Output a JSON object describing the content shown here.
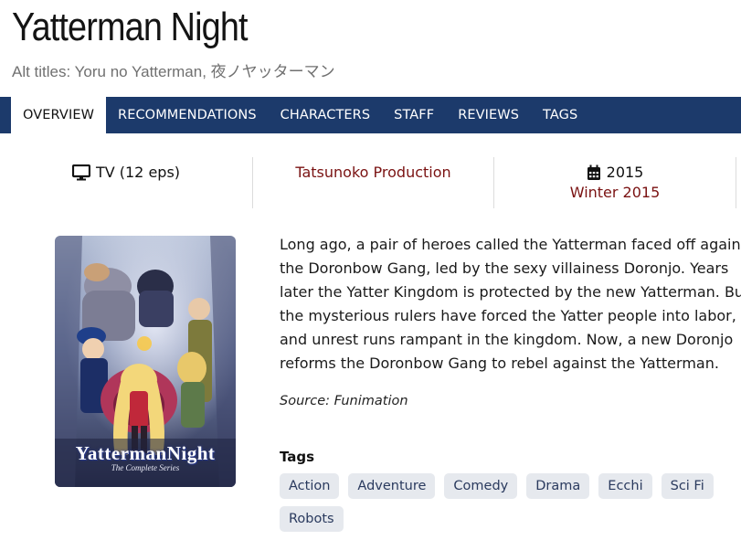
{
  "title": "Yatterman Night",
  "alt_titles": "Alt titles: Yoru no Yatterman, 夜ノヤッターマン",
  "nav": {
    "tabs": [
      {
        "label": "OVERVIEW",
        "active": true
      },
      {
        "label": "RECOMMENDATIONS"
      },
      {
        "label": "CHARACTERS"
      },
      {
        "label": "STAFF"
      },
      {
        "label": "REVIEWS"
      },
      {
        "label": "TAGS"
      }
    ]
  },
  "info": {
    "format": "TV (12 eps)",
    "format_icon": "tv-icon",
    "studio": "Tatsunoko Production",
    "year": "2015",
    "year_icon": "calendar-icon",
    "season": "Winter 2015"
  },
  "poster": {
    "logo_main": "YattermanNight",
    "logo_sub": "The Complete Series"
  },
  "synopsis": {
    "lines": [
      "Long ago, a pair of heroes called the Yatterman faced off again",
      "the Doronbow Gang, led by the sexy villainess Doronjo. Years",
      "later the Yatter Kingdom is protected by the new Yatterman. Bu",
      "the mysterious rulers have forced the Yatter people into labor,",
      "and unrest runs rampant in the kingdom. Now, a new Doronjo",
      "reforms the Doronbow Gang to rebel against the Yatterman."
    ],
    "source": "Source: Funimation"
  },
  "tags": {
    "heading": "Tags",
    "items": [
      "Action",
      "Adventure",
      "Comedy",
      "Drama",
      "Ecchi",
      "Sci Fi",
      "Robots"
    ]
  },
  "colors": {
    "nav_bg": "#1c3a6b",
    "link": "#7a1212",
    "tag_bg": "#e6e9ee"
  }
}
